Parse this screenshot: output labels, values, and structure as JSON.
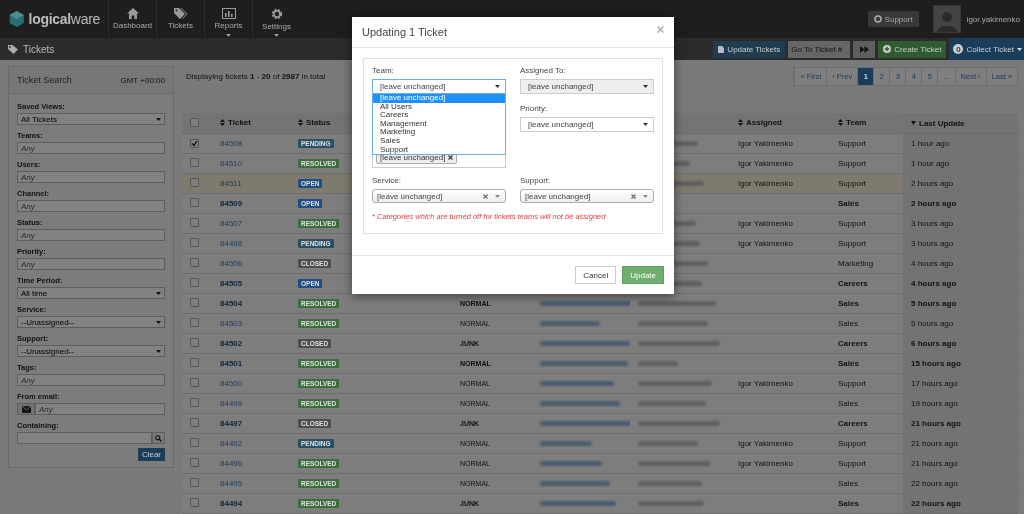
{
  "navbar": {
    "logo": "**logical**ware",
    "items": [
      {
        "label": "Dashboard",
        "kind": "home",
        "has_menu": false
      },
      {
        "label": "Tickets",
        "kind": "tags",
        "has_menu": false
      },
      {
        "label": "Reports",
        "kind": "chart",
        "has_menu": true
      },
      {
        "label": "Settings",
        "kind": "gear",
        "has_menu": true
      }
    ],
    "support_button": "Support",
    "username": "igor.yakimenko"
  },
  "toolbar": {
    "title": "Tickets",
    "update_button": "Update Tickets",
    "goto": {
      "placeholder": "Go To Ticket #"
    },
    "create_button": "Create Ticket",
    "collect_button": {
      "count": "0",
      "label": "Collect Ticket"
    }
  },
  "search_panel": {
    "title": "Ticket Search",
    "timezone": "GMT +00:00",
    "fields": [
      {
        "kind": "select",
        "label": "Saved Views:",
        "value": "All Tickets"
      },
      {
        "kind": "text",
        "label": "Teams:",
        "placeholder": "Any"
      },
      {
        "kind": "text",
        "label": "Users:",
        "placeholder": "Any"
      },
      {
        "kind": "text",
        "label": "Channel:",
        "placeholder": "Any"
      },
      {
        "kind": "text",
        "label": "Status:",
        "placeholder": "Any"
      },
      {
        "kind": "text",
        "label": "Priority:",
        "placeholder": "Any"
      },
      {
        "kind": "select",
        "label": "Time Period:",
        "value": "All time"
      },
      {
        "kind": "select",
        "label": "Service:",
        "value": "--Unassigned--"
      },
      {
        "kind": "select",
        "label": "Support:",
        "value": "--Unassigned--"
      },
      {
        "kind": "text",
        "label": "Tags:",
        "placeholder": "Any"
      },
      {
        "kind": "email",
        "label": "From email:",
        "placeholder": "Any"
      },
      {
        "kind": "search",
        "label": "Containing:"
      }
    ],
    "clear_button": "Clear"
  },
  "tickets": {
    "summary": "Displaying tickets **1** - **20** of **2987** in total",
    "pagination": [
      {
        "label": "« First",
        "selected": false
      },
      {
        "label": "‹ Prev",
        "selected": false
      },
      {
        "label": "1",
        "selected": true
      },
      {
        "label": "2",
        "selected": false
      },
      {
        "label": "3",
        "selected": false
      },
      {
        "label": "4",
        "selected": false
      },
      {
        "label": "5",
        "selected": false
      },
      {
        "label": "...",
        "selected": false
      },
      {
        "label": "Next ›",
        "selected": false
      },
      {
        "label": "Last »",
        "selected": false
      }
    ],
    "all_checked": false,
    "columns": {
      "ticket": {
        "label": "Ticket",
        "sorted": false
      },
      "status": {
        "label": "Status",
        "sorted": false
      },
      "assigned": {
        "label": "Assigned",
        "sorted": false
      },
      "team": {
        "label": "Team",
        "sorted": false
      },
      "updated": {
        "label": "Last Update",
        "sorted": true
      }
    },
    "rows": [
      {
        "checked": true,
        "highlighted": false,
        "unread": false,
        "ticket": "84508",
        "status": {
          "label": "PENDING",
          "color": "#2a5068"
        },
        "assigned": "Igor Yakimenko",
        "team": "Support",
        "updated": "1 hour ago"
      },
      {
        "checked": false,
        "highlighted": false,
        "unread": false,
        "ticket": "84510",
        "status": {
          "label": "RESOLVED",
          "color": "#3b6e3b"
        },
        "assigned": "Igor Yakimenko",
        "team": "Support",
        "updated": "1 hour ago"
      },
      {
        "checked": false,
        "highlighted": true,
        "unread": false,
        "ticket": "84511",
        "status": {
          "label": "OPEN",
          "color": "#1e4f80"
        },
        "assigned": "Igor Yakimenko",
        "team": "Support",
        "updated": "2 hours ago"
      },
      {
        "checked": false,
        "highlighted": false,
        "unread": true,
        "ticket": "84509",
        "status": {
          "label": "OPEN",
          "color": "#1e4f80"
        },
        "team": "Sales",
        "updated": "2 hours ago"
      },
      {
        "checked": false,
        "highlighted": false,
        "unread": false,
        "ticket": "84507",
        "status": {
          "label": "RESOLVED",
          "color": "#3b6e3b"
        },
        "assigned": "Igor Yakimenko",
        "team": "Support",
        "updated": "3 hours ago"
      },
      {
        "checked": false,
        "highlighted": false,
        "unread": false,
        "ticket": "84498",
        "status": {
          "label": "PENDING",
          "color": "#2a5068"
        },
        "assigned": "Igor Yakimenko",
        "team": "Support",
        "updated": "3 hours ago"
      },
      {
        "checked": false,
        "highlighted": false,
        "unread": false,
        "ticket": "84506",
        "status": {
          "label": "CLOSED",
          "color": "#4d4d4d"
        },
        "team": "Marketing",
        "updated": "4 hours ago"
      },
      {
        "checked": false,
        "highlighted": false,
        "unread": true,
        "ticket": "84505",
        "status": {
          "label": "OPEN",
          "color": "#1e4f80"
        },
        "team": "Careers",
        "updated": "4 hours ago"
      },
      {
        "checked": false,
        "highlighted": false,
        "unread": true,
        "ticket": "84504",
        "status": {
          "label": "RESOLVED",
          "color": "#3b6e3b"
        },
        "priority": "NORMAL",
        "team": "Sales",
        "updated": "5 hours ago"
      },
      {
        "checked": false,
        "highlighted": false,
        "unread": false,
        "ticket": "84503",
        "status": {
          "label": "RESOLVED",
          "color": "#3b6e3b"
        },
        "priority": "NORMAL",
        "team": "Sales",
        "updated": "5 hours ago"
      },
      {
        "checked": false,
        "highlighted": false,
        "unread": true,
        "ticket": "84502",
        "status": {
          "label": "CLOSED",
          "color": "#4d4d4d"
        },
        "priority": "JUNK",
        "team": "Careers",
        "updated": "6 hours ago"
      },
      {
        "checked": false,
        "highlighted": false,
        "unread": true,
        "ticket": "84501",
        "status": {
          "label": "RESOLVED",
          "color": "#3b6e3b"
        },
        "priority": "NORMAL",
        "team": "Sales",
        "updated": "15 hours ago"
      },
      {
        "checked": false,
        "highlighted": false,
        "unread": false,
        "ticket": "84500",
        "status": {
          "label": "RESOLVED",
          "color": "#3b6e3b"
        },
        "priority": "NORMAL",
        "assigned": "Igor Yakimenko",
        "team": "Support",
        "updated": "17 hours ago"
      },
      {
        "checked": false,
        "highlighted": false,
        "unread": false,
        "ticket": "84499",
        "status": {
          "label": "RESOLVED",
          "color": "#3b6e3b"
        },
        "priority": "NORMAL",
        "team": "Sales",
        "updated": "19 hours ago"
      },
      {
        "checked": false,
        "highlighted": false,
        "unread": true,
        "ticket": "84497",
        "status": {
          "label": "CLOSED",
          "color": "#4d4d4d"
        },
        "priority": "JUNK",
        "team": "Careers",
        "updated": "21 hours ago"
      },
      {
        "checked": false,
        "highlighted": false,
        "unread": false,
        "ticket": "84492",
        "status": {
          "label": "PENDING",
          "color": "#2a5068"
        },
        "priority": "NORMAL",
        "assigned": "Igor Yakimenko",
        "team": "Support",
        "updated": "21 hours ago"
      },
      {
        "checked": false,
        "highlighted": false,
        "unread": false,
        "ticket": "84496",
        "status": {
          "label": "RESOLVED",
          "color": "#3b6e3b"
        },
        "priority": "NORMAL",
        "assigned": "Igor Yakimenko",
        "team": "Support",
        "updated": "21 hours ago"
      },
      {
        "checked": false,
        "highlighted": false,
        "unread": false,
        "ticket": "84495",
        "status": {
          "label": "RESOLVED",
          "color": "#3b6e3b"
        },
        "priority": "NORMAL",
        "team": "Sales",
        "updated": "22 hours ago"
      },
      {
        "checked": false,
        "highlighted": false,
        "unread": true,
        "ticket": "84494",
        "status": {
          "label": "RESOLVED",
          "color": "#3b6e3b"
        },
        "priority": "JUNK",
        "team": "Sales",
        "updated": "22 hours ago"
      }
    ]
  },
  "modal": {
    "title": "Updating 1 Ticket",
    "team": {
      "label": "Team:",
      "value": "[leave unchanged]",
      "options": [
        {
          "label": "[leave unchanged]",
          "selected": true
        },
        {
          "label": "All Users",
          "selected": false
        },
        {
          "label": "Careers",
          "selected": false
        },
        {
          "label": "Management",
          "selected": false
        },
        {
          "label": "Marketing",
          "selected": false
        },
        {
          "label": "Sales",
          "selected": false
        },
        {
          "label": "Support",
          "selected": false
        }
      ],
      "tags": [
        "[leave unchanged]"
      ]
    },
    "assigned": {
      "label": "Assigned To:",
      "value": "[leave unchanged]",
      "disabled": true
    },
    "priority": {
      "label": "Priority:",
      "value": "[leave unchanged]",
      "disabled": false
    },
    "service": {
      "label": "Service:",
      "value": "[leave unchanged]"
    },
    "support": {
      "label": "Support:",
      "value": "[leave unchanged]"
    },
    "note": "* Categories which are turned off for tickets teams will not be assigned",
    "cancel_button": "Cancel",
    "update_button": "Update"
  }
}
